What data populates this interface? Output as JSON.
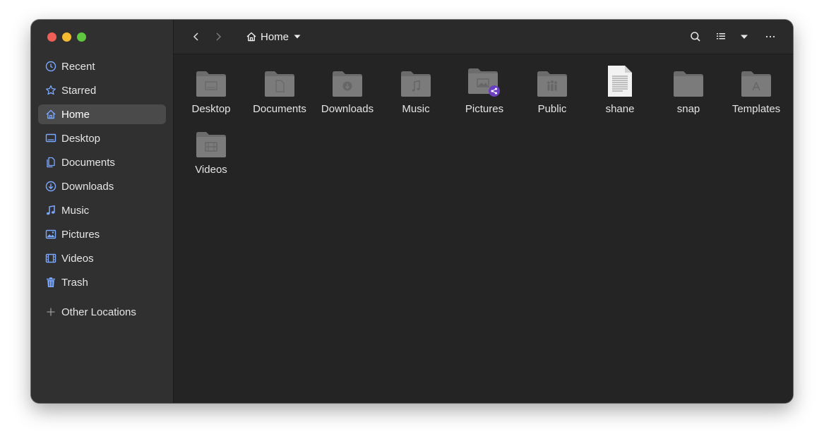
{
  "sidebar": {
    "items": [
      {
        "label": "Recent",
        "icon": "clock-icon"
      },
      {
        "label": "Starred",
        "icon": "star-icon"
      },
      {
        "label": "Home",
        "icon": "home-icon"
      },
      {
        "label": "Desktop",
        "icon": "desktop-icon"
      },
      {
        "label": "Documents",
        "icon": "documents-icon"
      },
      {
        "label": "Downloads",
        "icon": "download-icon"
      },
      {
        "label": "Music",
        "icon": "music-icon"
      },
      {
        "label": "Pictures",
        "icon": "pictures-icon"
      },
      {
        "label": "Videos",
        "icon": "videos-icon"
      },
      {
        "label": "Trash",
        "icon": "trash-icon"
      }
    ],
    "other_locations": "Other Locations",
    "active": "Home"
  },
  "header": {
    "path_label": "Home"
  },
  "files": [
    {
      "name": "Desktop",
      "kind": "folder",
      "emblem": "desktop"
    },
    {
      "name": "Documents",
      "kind": "folder",
      "emblem": "document"
    },
    {
      "name": "Downloads",
      "kind": "folder",
      "emblem": "download"
    },
    {
      "name": "Music",
      "kind": "folder",
      "emblem": "music"
    },
    {
      "name": "Pictures",
      "kind": "folder",
      "emblem": "pictures"
    },
    {
      "name": "Public",
      "kind": "folder",
      "emblem": "public"
    },
    {
      "name": "shane",
      "kind": "text-file",
      "emblem": "text"
    },
    {
      "name": "snap",
      "kind": "folder",
      "emblem": "none"
    },
    {
      "name": "Templates",
      "kind": "folder",
      "emblem": "templates"
    },
    {
      "name": "Videos",
      "kind": "folder",
      "emblem": "videos"
    }
  ],
  "colors": {
    "accent": "#7aa7ff",
    "folder": "#7b7b7b",
    "share_badge": "#6a3fc0"
  }
}
